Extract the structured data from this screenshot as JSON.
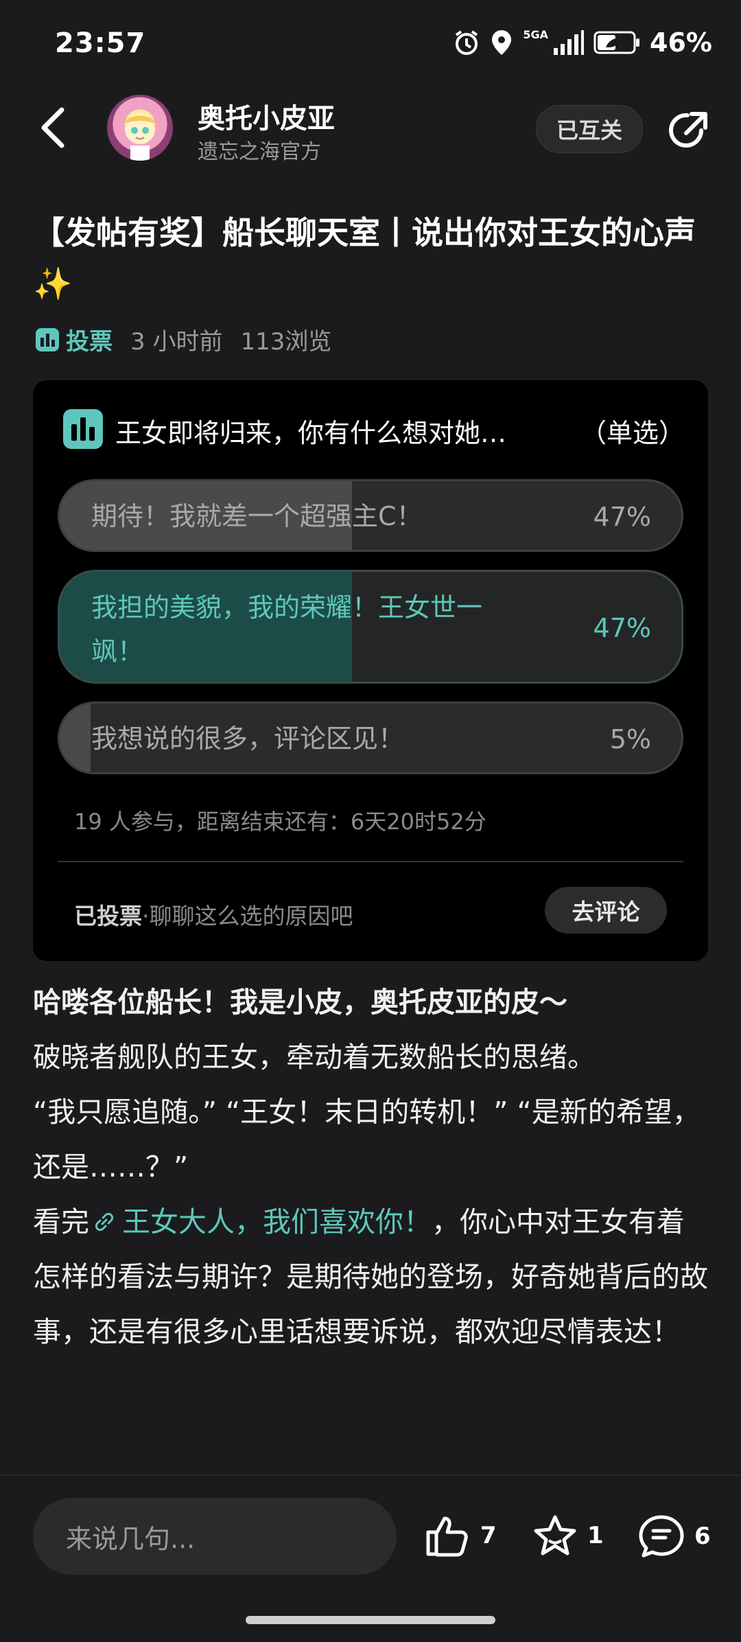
{
  "status_bar": {
    "time": "23:57",
    "network": "5GA",
    "battery": "46%"
  },
  "header": {
    "author_name": "奥托小皮亚",
    "author_sub": "遗忘之海官方",
    "follow_label": "已互关"
  },
  "post": {
    "title": "【发帖有奖】船长聊天室丨说出你对王女的心声✨",
    "tag": "投票",
    "time": "3 小时前",
    "views": "113浏览"
  },
  "poll": {
    "question": "王女即将归来，你有什么想对她…",
    "mode": "（单选）",
    "options": [
      {
        "line1": "期待！我就差一个超强主C！",
        "line2": "",
        "pct_label": "47%",
        "fraction": 0.47,
        "selected": false
      },
      {
        "line1": "我担的美貌，我的荣耀！王女世一",
        "line2": "飒！",
        "pct_label": "47%",
        "fraction": 0.47,
        "selected": true
      },
      {
        "line1": "我想说的很多，评论区见！",
        "line2": "",
        "pct_label": "5%",
        "fraction": 0.05,
        "selected": false
      }
    ],
    "participants": "19 人参与，距离结束还有：6天20时52分",
    "voted_bold": "已投票",
    "voted_rest": "·聊聊这么选的原因吧",
    "comment_button": "去评论"
  },
  "body": {
    "greeting": "哈喽各位船长！我是小皮，奥托皮亚的皮～",
    "para1": "破晓者舰队的王女，牵动着无数船长的思绪。",
    "para2": "“我只愿追随。” “王女！末日的转机！” “是新的希望，还是……？”",
    "para3_prefix": "看完",
    "para3_link": "王女大人，我们喜欢你！",
    "para3_suffix": "，你心中对王女有着怎样的看法与期许？是期待她的登场，好奇她背后的故事，还是有很多心里话想要诉说，都欢迎尽情表达！"
  },
  "bottom_bar": {
    "input_placeholder": "来说几句...",
    "likes": "7",
    "favorites": "1",
    "comments": "6"
  },
  "colors": {
    "accent": "#5ec7bb",
    "background": "#1b1b1d",
    "card": "#000000"
  }
}
